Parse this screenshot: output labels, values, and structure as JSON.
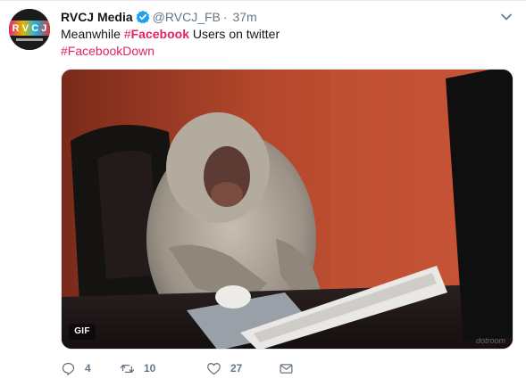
{
  "tweet": {
    "display_name": "RVCJ Media",
    "verified": true,
    "handle": "@RVCJ_FB",
    "separator": "·",
    "time": "37m",
    "avatar_letters": [
      "R",
      "V",
      "C",
      "J"
    ],
    "text": {
      "pre": "Meanwhile ",
      "hashtag_symbol": "#",
      "hashtag_word": "Facebook",
      "post": " Users on twitter",
      "hashtag2": "#FacebookDown"
    },
    "media": {
      "badge": "GIF",
      "watermark": "dotroom"
    },
    "actions": {
      "reply_count": "4",
      "retweet_count": "10",
      "like_count": "27"
    }
  },
  "icons": {
    "verified": "verified-badge-icon",
    "caret": "chevron-down-icon",
    "reply": "reply-icon",
    "retweet": "retweet-icon",
    "like": "heart-icon",
    "message": "envelope-icon"
  },
  "colors": {
    "hashtag": "#e0245e",
    "verified": "#1da1f2",
    "secondary_text": "#657786"
  }
}
